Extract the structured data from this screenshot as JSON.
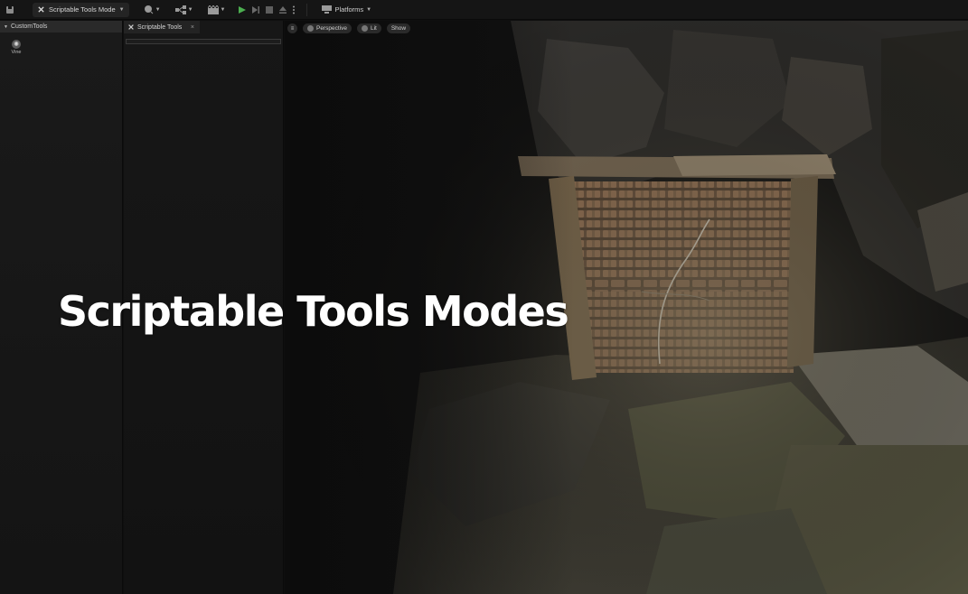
{
  "toolbar": {
    "mode_label": "Scriptable Tools Mode",
    "platforms_label": "Platforms"
  },
  "left_panel": {
    "category": "CustomTools",
    "tool_label": "Vine"
  },
  "tools_panel": {
    "tab_label": "Scriptable Tools",
    "close_glyph": "×"
  },
  "viewport": {
    "perspective_label": "Perspective",
    "lit_label": "Lit",
    "show_label": "Show"
  },
  "overlay": {
    "title": "Scriptable Tools Modes"
  },
  "colors": {
    "toolbar_bg": "#151515",
    "panel_bg": "#171717",
    "play_green": "#4caf50",
    "title_text": "#ffffff"
  }
}
